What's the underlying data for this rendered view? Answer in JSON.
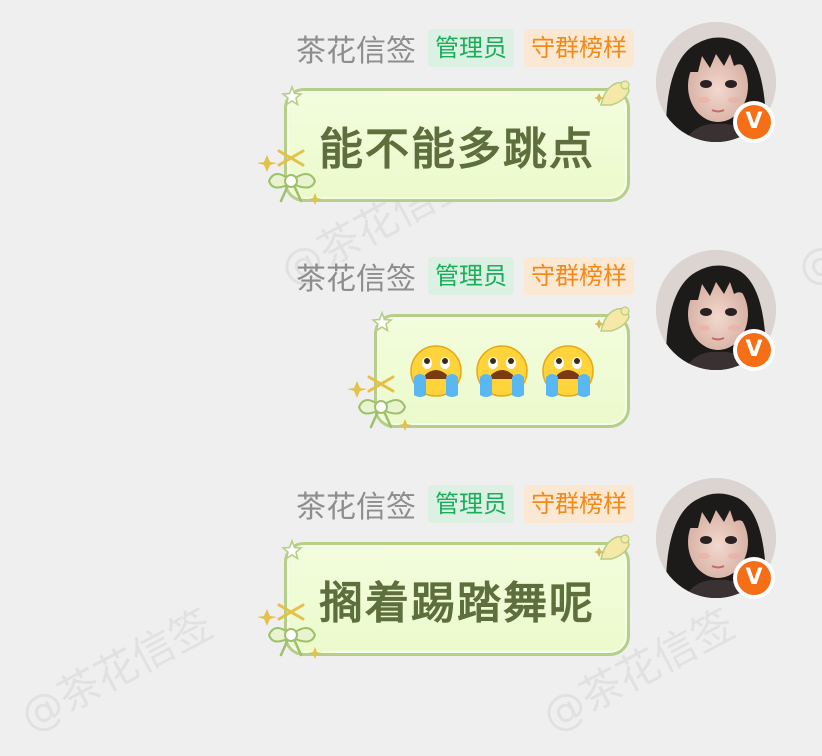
{
  "watermarks": [
    "@茶花信签",
    "@茶花信签",
    "@茶花信签",
    "@茶花信签"
  ],
  "messages": [
    {
      "sender": "茶花信签",
      "badge_admin": "管理员",
      "badge_rank": "守群榜样",
      "text": "能不能多跳点"
    },
    {
      "sender": "茶花信签",
      "badge_admin": "管理员",
      "badge_rank": "守群榜样",
      "emojis": [
        "crying-face-icon",
        "crying-face-icon",
        "crying-face-icon"
      ]
    },
    {
      "sender": "茶花信签",
      "badge_admin": "管理员",
      "badge_rank": "守群榜样",
      "text": "搁着踢踏舞呢"
    }
  ],
  "avatar_badge": "V",
  "colors": {
    "background": "#efefef",
    "admin_badge_bg": "#ddf0e4",
    "admin_badge_fg": "#1aad5a",
    "rank_badge_bg": "#fbe8d3",
    "rank_badge_fg": "#f28a1a",
    "bubble_border": "#b5cf86",
    "bubble_text": "#5c6f3c",
    "verified": "#f66e15"
  }
}
